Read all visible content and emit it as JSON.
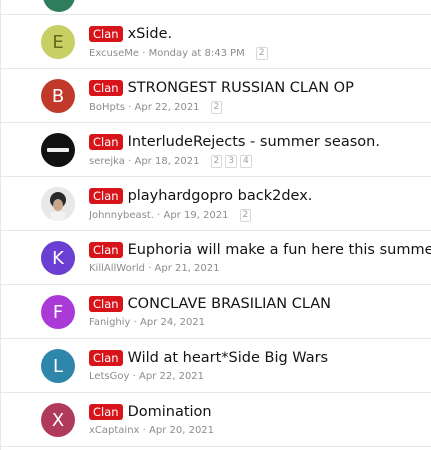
{
  "threads": [
    {
      "prefix": "Clan",
      "title": "xSide.",
      "author": "ExcuseMe",
      "date": "Monday at 8:43 PM",
      "pages": [
        "2"
      ],
      "avatar_letter": "E",
      "avatar_color": "#c8cf64",
      "avatar_type": "letter"
    },
    {
      "prefix": "Clan",
      "title": "STRONGEST RUSSIAN CLAN OP",
      "author": "BoHpts",
      "date": "Apr 22, 2021",
      "pages": [
        "2"
      ],
      "avatar_letter": "B",
      "avatar_color": "#c0392b",
      "avatar_type": "letter"
    },
    {
      "prefix": "Clan",
      "title": "InterludeRejects - summer season.",
      "author": "serejka",
      "date": "Apr 18, 2021",
      "pages": [
        "2",
        "3",
        "4"
      ],
      "avatar_letter": "",
      "avatar_color": "#111111",
      "avatar_type": "image"
    },
    {
      "prefix": "Clan",
      "title": "playhardgopro back2dex.",
      "author": "Johnnybeast.",
      "date": "Apr 19, 2021",
      "pages": [
        "2"
      ],
      "avatar_letter": "",
      "avatar_color": "#dddddd",
      "avatar_type": "photo"
    },
    {
      "prefix": "Clan",
      "title": "Euphoria will make a fun here this summer",
      "author": "KillAllWorld",
      "date": "Apr 21, 2021",
      "pages": [],
      "avatar_letter": "K",
      "avatar_color": "#6a3fd1",
      "avatar_type": "letter"
    },
    {
      "prefix": "Clan",
      "title": "CONCLAVE BRASILIAN CLAN",
      "author": "Fanighiy",
      "date": "Apr 24, 2021",
      "pages": [],
      "avatar_letter": "F",
      "avatar_color": "#a93ad6",
      "avatar_type": "letter"
    },
    {
      "prefix": "Clan",
      "title": "Wild at heart*Side Big Wars",
      "author": "LetsGoy",
      "date": "Apr 22, 2021",
      "pages": [],
      "avatar_letter": "L",
      "avatar_color": "#2e86ab",
      "avatar_type": "letter"
    },
    {
      "prefix": "Clan",
      "title": "Domination",
      "author": "xCaptainx",
      "date": "Apr 20, 2021",
      "pages": [],
      "avatar_letter": "X",
      "avatar_color": "#b03a5b",
      "avatar_type": "letter"
    }
  ]
}
